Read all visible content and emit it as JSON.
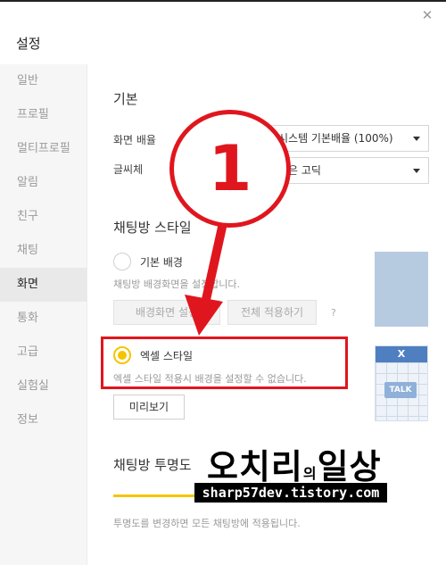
{
  "window": {
    "title": "설정",
    "close_icon": "close-icon"
  },
  "sidebar": {
    "items": [
      {
        "label": "일반",
        "active": false
      },
      {
        "label": "프로필",
        "active": false
      },
      {
        "label": "멀티프로필",
        "active": false
      },
      {
        "label": "알림",
        "active": false
      },
      {
        "label": "친구",
        "active": false
      },
      {
        "label": "채팅",
        "active": false
      },
      {
        "label": "화면",
        "active": true
      },
      {
        "label": "통화",
        "active": false
      },
      {
        "label": "고급",
        "active": false
      },
      {
        "label": "실험실",
        "active": false
      },
      {
        "label": "정보",
        "active": false
      }
    ]
  },
  "basic": {
    "title": "기본",
    "zoom_label": "화면 배율",
    "zoom_value": "시스템 기본배율 (100%)",
    "font_label": "글씨체",
    "font_value": "맑은 고딕"
  },
  "chat_style": {
    "title": "채팅방 스타일",
    "default_bg_label": "기본 배경",
    "default_bg_hint": "채팅방 배경화면을 설정합니다.",
    "set_bg_button": "배경화면 설정",
    "apply_all_button": "전체 적용하기",
    "help_label": "?",
    "excel_label": "엑셀 스타일",
    "excel_hint": "엑셀 스타일 적용시 배경을 설정할 수 없습니다.",
    "preview_button": "미리보기",
    "excel_preview_badge": "X",
    "excel_preview_talk": "TALK"
  },
  "transparency": {
    "title": "채팅방 투명도",
    "hint": "투명도를 변경하면 모든 채팅방에 적용됩니다."
  },
  "overlay": {
    "step_number": "1",
    "watermark_main": "오치리",
    "watermark_particle": "의",
    "watermark_tail": "일상",
    "watermark_url": "sharp57dev.tistory.com",
    "accent_color": "#e0161e"
  },
  "colors": {
    "selected_radio": "#f5c400",
    "sidebar_bg": "#f6f6f6",
    "active_item_bg": "#e9e9e9"
  }
}
